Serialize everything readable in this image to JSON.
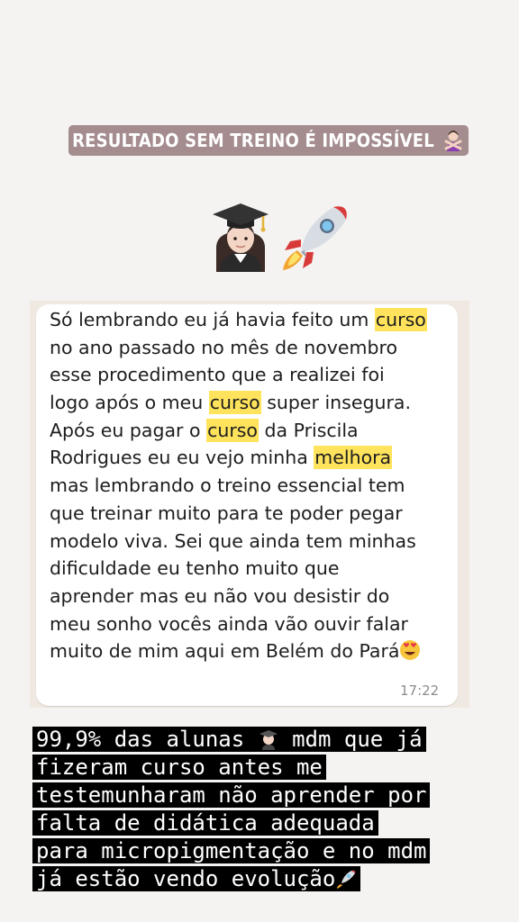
{
  "header": {
    "title": "RESULTADO SEM TREINO É IMPOSSÍVEL",
    "title_icon": "woman-gesturing-no-icon"
  },
  "decorations": [
    "graduate-woman-icon",
    "rocket-icon"
  ],
  "message": {
    "lines": [
      [
        "Só lembrando eu já havia feito um ",
        {
          "hl": "curso"
        }
      ],
      [
        "no ano passado no mês de novembro"
      ],
      [
        "esse procedimento que a realizei foi"
      ],
      [
        "logo após o meu ",
        {
          "hl": "curso"
        },
        " super insegura."
      ],
      [
        "Após eu pagar o ",
        {
          "hl": "curso"
        },
        " da Priscila"
      ],
      [
        "Rodrigues eu eu vejo minha ",
        {
          "hl": "melhora"
        }
      ],
      [
        "mas lembrando o  treino essencial tem"
      ],
      [
        "que treinar muito para te poder pegar"
      ],
      [
        "modelo viva. Sei que ainda tem minhas"
      ],
      [
        "dificuldade eu tenho muito que"
      ],
      [
        "aprender mas eu não vou desistir do"
      ],
      [
        "meu sonho vocês ainda vão ouvir falar"
      ],
      [
        "muito de mim aqui em Belém do Pará"
      ]
    ],
    "end_icon": "heart-eyes-icon",
    "time": "17:22",
    "highlight_color": "#ffe35c"
  },
  "caption": {
    "lines": [
      "99,9% das alunas ",
      "fizeram curso antes me",
      "testemunharam não aprender por",
      "falta de didática adequada",
      "para micropigmentação e no mdm",
      "já estão vendo evolução"
    ],
    "line1_tail": " mdm que já",
    "inline_icon_line1": "graduate-woman-icon",
    "inline_icon_last": "rocket-icon"
  },
  "colors": {
    "background": "#f5f3f1",
    "title_pill": "#a48c8f",
    "caption_bg": "#000000",
    "caption_text": "#ffffff"
  }
}
